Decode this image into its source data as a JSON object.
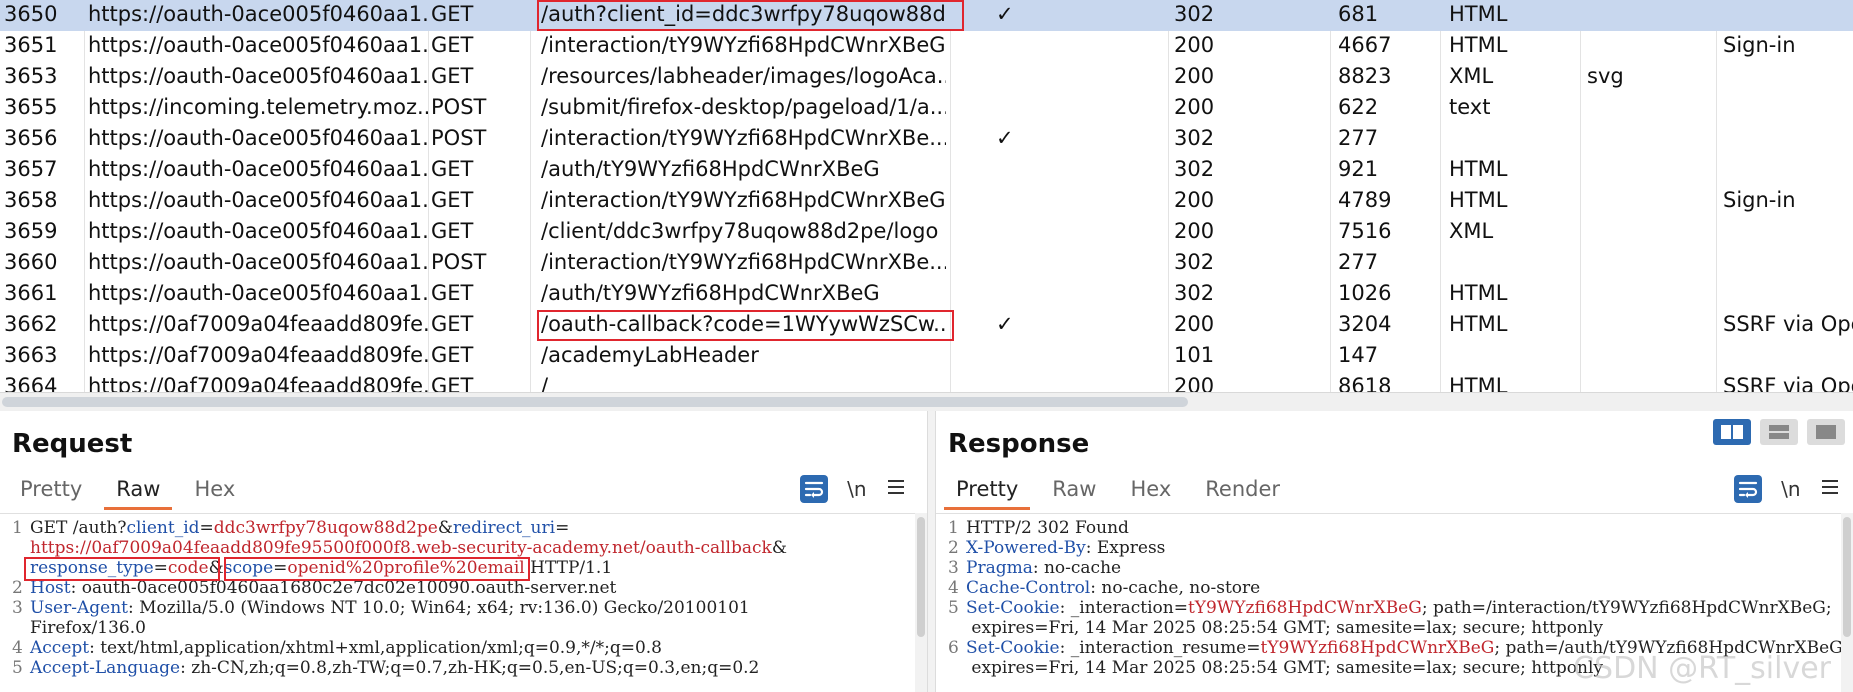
{
  "history": {
    "rows": [
      {
        "num": "3650",
        "host": "https://oauth-0ace005f0460aa1...",
        "method": "GET",
        "path": "/auth?client_id=ddc3wrfpy78uqow88d...",
        "edited": "✓",
        "status": "302",
        "length": "681",
        "mime": "HTML",
        "ext": "",
        "title": "",
        "selected": true,
        "highlight": true
      },
      {
        "num": "3651",
        "host": "https://oauth-0ace005f0460aa1...",
        "method": "GET",
        "path": "/interaction/tY9WYzfi68HpdCWnrXBeG",
        "edited": "",
        "status": "200",
        "length": "4667",
        "mime": "HTML",
        "ext": "",
        "title": "Sign-in"
      },
      {
        "num": "3653",
        "host": "https://oauth-0ace005f0460aa1...",
        "method": "GET",
        "path": "/resources/labheader/images/logoAca...",
        "edited": "",
        "status": "200",
        "length": "8823",
        "mime": "XML",
        "ext": "svg",
        "title": ""
      },
      {
        "num": "3655",
        "host": "https://incoming.telemetry.moz...",
        "method": "POST",
        "path": "/submit/firefox-desktop/pageload/1/a...",
        "edited": "",
        "status": "200",
        "length": "622",
        "mime": "text",
        "ext": "",
        "title": ""
      },
      {
        "num": "3656",
        "host": "https://oauth-0ace005f0460aa1...",
        "method": "POST",
        "path": "/interaction/tY9WYzfi68HpdCWnrXBe...",
        "edited": "✓",
        "status": "302",
        "length": "277",
        "mime": "",
        "ext": "",
        "title": ""
      },
      {
        "num": "3657",
        "host": "https://oauth-0ace005f0460aa1...",
        "method": "GET",
        "path": "/auth/tY9WYzfi68HpdCWnrXBeG",
        "edited": "",
        "status": "302",
        "length": "921",
        "mime": "HTML",
        "ext": "",
        "title": ""
      },
      {
        "num": "3658",
        "host": "https://oauth-0ace005f0460aa1...",
        "method": "GET",
        "path": "/interaction/tY9WYzfi68HpdCWnrXBeG",
        "edited": "",
        "status": "200",
        "length": "4789",
        "mime": "HTML",
        "ext": "",
        "title": "Sign-in"
      },
      {
        "num": "3659",
        "host": "https://oauth-0ace005f0460aa1...",
        "method": "GET",
        "path": "/client/ddc3wrfpy78uqow88d2pe/logo",
        "edited": "",
        "status": "200",
        "length": "7516",
        "mime": "XML",
        "ext": "",
        "title": ""
      },
      {
        "num": "3660",
        "host": "https://oauth-0ace005f0460aa1...",
        "method": "POST",
        "path": "/interaction/tY9WYzfi68HpdCWnrXBe...",
        "edited": "",
        "status": "302",
        "length": "277",
        "mime": "",
        "ext": "",
        "title": ""
      },
      {
        "num": "3661",
        "host": "https://oauth-0ace005f0460aa1...",
        "method": "GET",
        "path": "/auth/tY9WYzfi68HpdCWnrXBeG",
        "edited": "",
        "status": "302",
        "length": "1026",
        "mime": "HTML",
        "ext": "",
        "title": ""
      },
      {
        "num": "3662",
        "host": "https://0af7009a04feaadd809fe...",
        "method": "GET",
        "path": "/oauth-callback?code=1WYywWzSCw...",
        "edited": "✓",
        "status": "200",
        "length": "3204",
        "mime": "HTML",
        "ext": "",
        "title": "SSRF via Ope",
        "highlight": true
      },
      {
        "num": "3663",
        "host": "https://0af7009a04feaadd809fe...",
        "method": "GET",
        "path": "/academyLabHeader",
        "edited": "",
        "status": "101",
        "length": "147",
        "mime": "",
        "ext": "",
        "title": ""
      },
      {
        "num": "3664",
        "host": "https://0af7009a04feaadd809fe...",
        "method": "GET",
        "path": "/",
        "edited": "",
        "status": "200",
        "length": "8618",
        "mime": "HTML",
        "ext": "",
        "title": "SSRF via Ope"
      }
    ]
  },
  "request": {
    "title": "Request",
    "tabs": [
      "Pretty",
      "Raw",
      "Hex"
    ],
    "active_tab": "Raw",
    "newline_label": "\\n",
    "lines": [
      {
        "n": "1",
        "segs": [
          [
            "t",
            "GET /auth?"
          ],
          [
            "k",
            "client_id"
          ],
          [
            "t",
            "="
          ],
          [
            "v",
            "ddc3wrfpy78uqow88d2pe"
          ],
          [
            "t",
            "&"
          ],
          [
            "k",
            "redirect_uri"
          ],
          [
            "t",
            "="
          ]
        ]
      },
      {
        "n": "",
        "segs": [
          [
            "v",
            "https://0af7009a04feaadd809fe95500f000f8.web-security-academy.net/oauth-callback"
          ],
          [
            "t",
            "&"
          ]
        ]
      },
      {
        "n": "",
        "segs": [
          [
            "k",
            "response_type"
          ],
          [
            "t",
            "="
          ],
          [
            "v",
            "code"
          ],
          [
            "t",
            "&"
          ],
          [
            "k",
            "scope"
          ],
          [
            "t",
            "="
          ],
          [
            "v",
            "openid%20profile%20email"
          ],
          [
            "t",
            " HTTP/1.1"
          ]
        ]
      },
      {
        "n": "2",
        "segs": [
          [
            "k",
            "Host"
          ],
          [
            "t",
            ": oauth-0ace005f0460aa1680c2e7dc02e10090.oauth-server.net"
          ]
        ]
      },
      {
        "n": "3",
        "segs": [
          [
            "k",
            "User-Agent"
          ],
          [
            "t",
            ": Mozilla/5.0 (Windows NT 10.0; Win64; x64; rv:136.0) Gecko/20100101"
          ]
        ]
      },
      {
        "n": "",
        "segs": [
          [
            "t",
            "Firefox/136.0"
          ]
        ]
      },
      {
        "n": "4",
        "segs": [
          [
            "k",
            "Accept"
          ],
          [
            "t",
            ": text/html,application/xhtml+xml,application/xml;q=0.9,*/*;q=0.8"
          ]
        ]
      },
      {
        "n": "5",
        "segs": [
          [
            "k",
            "Accept-Language"
          ],
          [
            "t",
            ": zh-CN,zh;q=0.8,zh-TW;q=0.7,zh-HK;q=0.5,en-US;q=0.3,en;q=0.2"
          ]
        ]
      }
    ]
  },
  "response": {
    "title": "Response",
    "tabs": [
      "Pretty",
      "Raw",
      "Hex",
      "Render"
    ],
    "active_tab": "Pretty",
    "newline_label": "\\n",
    "lines": [
      {
        "n": "1",
        "segs": [
          [
            "t",
            "HTTP/2 302 Found"
          ]
        ]
      },
      {
        "n": "2",
        "segs": [
          [
            "k",
            "X-Powered-By"
          ],
          [
            "t",
            ": Express"
          ]
        ]
      },
      {
        "n": "3",
        "segs": [
          [
            "k",
            "Pragma"
          ],
          [
            "t",
            ": no-cache"
          ]
        ]
      },
      {
        "n": "4",
        "segs": [
          [
            "k",
            "Cache-Control"
          ],
          [
            "t",
            ": no-cache, no-store"
          ]
        ]
      },
      {
        "n": "5",
        "segs": [
          [
            "k",
            "Set-Cookie"
          ],
          [
            "t",
            ": _interaction="
          ],
          [
            "v",
            "tY9WYzfi68HpdCWnrXBeG"
          ],
          [
            "t",
            "; path=/interaction/tY9WYzfi68HpdCWnrXBeG;"
          ]
        ]
      },
      {
        "n": "",
        "segs": [
          [
            "t",
            " expires=Fri, 14 Mar 2025 08:25:54 GMT; samesite=lax; secure; httponly"
          ]
        ]
      },
      {
        "n": "6",
        "segs": [
          [
            "k",
            "Set-Cookie"
          ],
          [
            "t",
            ": _interaction_resume="
          ],
          [
            "v",
            "tY9WYzfi68HpdCWnrXBeG"
          ],
          [
            "t",
            "; path=/auth/tY9WYzfi68HpdCWnrXBeG;"
          ]
        ]
      },
      {
        "n": "",
        "segs": [
          [
            "t",
            " expires=Fri, 14 Mar 2025 08:25:54 GMT; samesite=lax; secure; httponly"
          ]
        ]
      }
    ]
  },
  "watermark": "CSDN @RT_silver",
  "colors": {
    "selected_row": "#c8d7ee",
    "highlight_box": "#e0262e",
    "accent": "#2d6ab1",
    "tab_underline": "#e8703a",
    "param_key": "#2050a8",
    "param_value": "#c0262d"
  }
}
